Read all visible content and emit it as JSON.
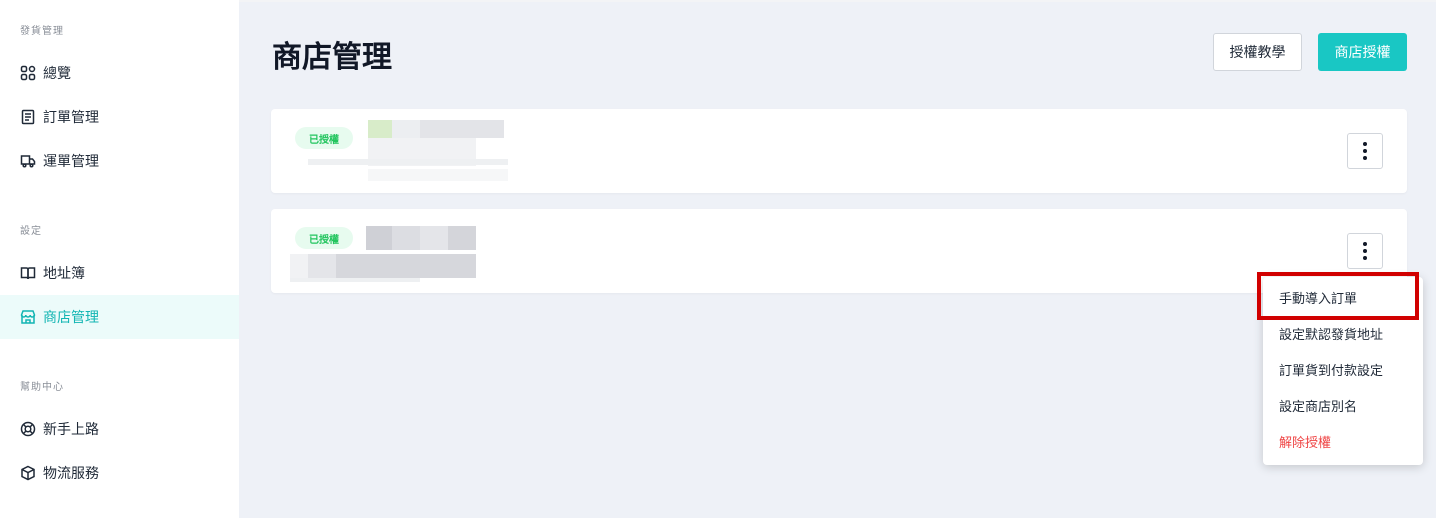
{
  "sidebar": {
    "sections": [
      {
        "label": "發貨管理",
        "items": [
          {
            "label": "總覽",
            "icon": "grid-icon"
          },
          {
            "label": "訂單管理",
            "icon": "document-icon"
          },
          {
            "label": "運單管理",
            "icon": "truck-icon"
          }
        ]
      },
      {
        "label": "設定",
        "items": [
          {
            "label": "地址簿",
            "icon": "book-icon"
          },
          {
            "label": "商店管理",
            "icon": "store-icon",
            "active": true
          }
        ]
      },
      {
        "label": "幫助中心",
        "items": [
          {
            "label": "新手上路",
            "icon": "lifebuoy-icon"
          },
          {
            "label": "物流服務",
            "icon": "box-icon"
          }
        ]
      }
    ]
  },
  "header": {
    "title": "商店管理",
    "tutorial_button": "授權教學",
    "authorize_button": "商店授權"
  },
  "stores": [
    {
      "status": "已授權"
    },
    {
      "status": "已授權"
    }
  ],
  "menu": {
    "items": [
      {
        "label": "手動導入訂單"
      },
      {
        "label": "設定默認發貨地址"
      },
      {
        "label": "訂單貨到付款設定"
      },
      {
        "label": "設定商店別名"
      },
      {
        "label": "解除授權",
        "danger": true
      }
    ]
  },
  "colors": {
    "accent": "#19c7c4",
    "active_bg": "#ecfbfa",
    "badge_green": "#22c55e",
    "danger": "#ef4444",
    "highlight": "#d10000"
  }
}
